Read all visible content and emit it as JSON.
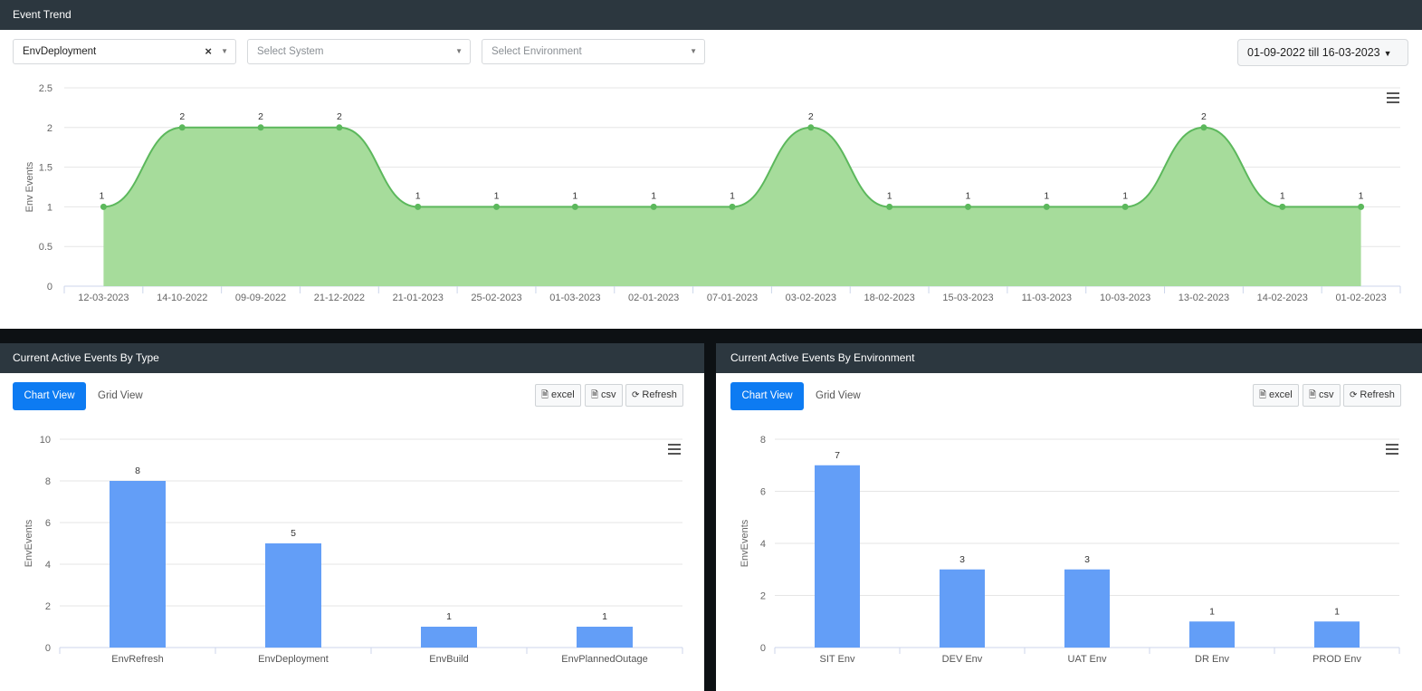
{
  "trend": {
    "title": "Event Trend",
    "filters": {
      "type_value": "EnvDeployment",
      "system_placeholder": "Select System",
      "environment_placeholder": "Select Environment"
    },
    "date_range": "01-09-2022 till 16-03-2023",
    "chart_data": {
      "type": "area",
      "title": "",
      "xlabel": "",
      "ylabel": "Env Events",
      "ylim": [
        0,
        2.5
      ],
      "yticks": [
        "0",
        "0.5",
        "1",
        "1.5",
        "2",
        "2.5"
      ],
      "categories": [
        "12-03-2023",
        "14-10-2022",
        "09-09-2022",
        "21-12-2022",
        "21-01-2023",
        "25-02-2023",
        "01-03-2023",
        "02-01-2023",
        "07-01-2023",
        "03-02-2023",
        "18-02-2023",
        "15-03-2023",
        "11-03-2023",
        "10-03-2023",
        "13-02-2023",
        "14-02-2023",
        "01-02-2023"
      ],
      "values": [
        1,
        2,
        2,
        2,
        1,
        1,
        1,
        1,
        1,
        2,
        1,
        1,
        1,
        1,
        2,
        1,
        1
      ],
      "color": "#5cb85c",
      "fill": "#a6dc9b",
      "grid": true
    }
  },
  "by_type": {
    "title": "Current Active Events By Type",
    "chart_view_label": "Chart View",
    "grid_view_label": "Grid View",
    "excel_label": "excel",
    "csv_label": "csv",
    "refresh_label": "Refresh",
    "chart_data": {
      "type": "bar",
      "title": "",
      "xlabel": "",
      "ylabel": "EnvEvents",
      "ylim": [
        0,
        10
      ],
      "yticks": [
        "0",
        "2",
        "4",
        "6",
        "8",
        "10"
      ],
      "categories": [
        "EnvRefresh",
        "EnvDeployment",
        "EnvBuild",
        "EnvPlannedOutage"
      ],
      "values": [
        8,
        5,
        1,
        1
      ],
      "color": "#639ef7",
      "grid": true
    }
  },
  "by_env": {
    "title": "Current Active Events By Environment",
    "chart_view_label": "Chart View",
    "grid_view_label": "Grid View",
    "excel_label": "excel",
    "csv_label": "csv",
    "refresh_label": "Refresh",
    "chart_data": {
      "type": "bar",
      "title": "",
      "xlabel": "",
      "ylabel": "EnvEvents",
      "ylim": [
        0,
        8
      ],
      "yticks": [
        "0",
        "2",
        "4",
        "6",
        "8"
      ],
      "categories": [
        "SIT Env",
        "DEV Env",
        "UAT Env",
        "DR Env",
        "PROD Env"
      ],
      "values": [
        7,
        3,
        3,
        1,
        1
      ],
      "color": "#639ef7",
      "grid": true
    }
  }
}
